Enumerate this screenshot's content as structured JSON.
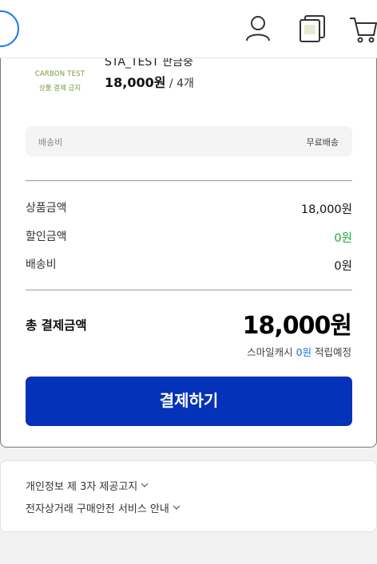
{
  "header": {
    "icons": [
      "user-icon",
      "recent-view-icon",
      "cart-icon"
    ]
  },
  "product": {
    "thumb_line1": "CARBON TEST",
    "thumb_line2": "상품 결제 금지",
    "name": "STA_TEST 판금중",
    "price": "18,000원",
    "quantity": " / 4개"
  },
  "shipping": {
    "label": "배송비",
    "value": "무료배송"
  },
  "summary": {
    "rows": [
      {
        "label": "상품금액",
        "value": "18,000원"
      },
      {
        "label": "할인금액",
        "value": "0원"
      },
      {
        "label": "배송비",
        "value": "0원"
      }
    ],
    "total_label": "총 결제금액",
    "total_value": "18,000원",
    "points_prefix": "스마일캐시 ",
    "points_value": "0원",
    "points_suffix": " 적립예정"
  },
  "pay_button": "결제하기",
  "notices": [
    {
      "label": "개인정보 제 3자 제공고지"
    },
    {
      "label": "전자상거래 구매안전 서비스 안내"
    }
  ],
  "colors": {
    "accent_blue": "#0432b8",
    "discount_green": "#1fa83a",
    "points_blue": "#1a6fdc"
  }
}
